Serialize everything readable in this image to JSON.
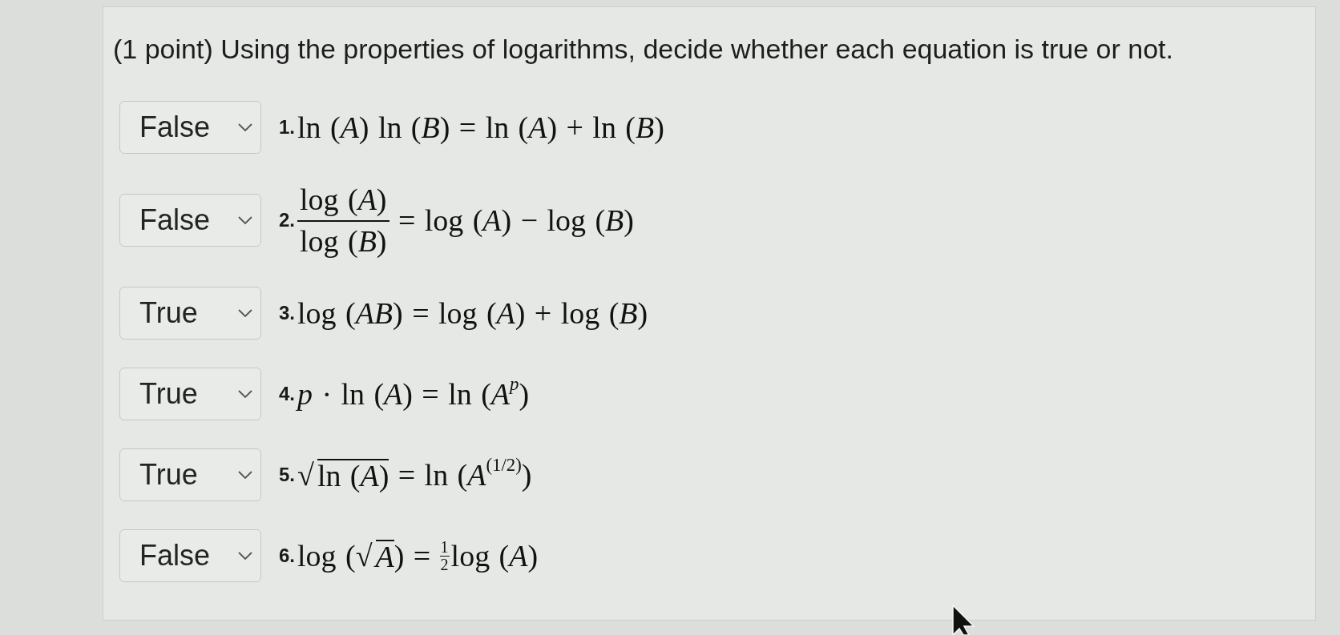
{
  "prompt": "(1 point) Using the properties of logarithms, decide whether each equation is true or not.",
  "questions": [
    {
      "answer": "False",
      "number": "1.",
      "equation": [
        {
          "kind": "text",
          "text": "ln (*A*) ln (*B*) = ln (*A*) + ln (*B*)"
        }
      ]
    },
    {
      "answer": "False",
      "number": "2.",
      "equation": [
        {
          "kind": "fraction",
          "numerator": "log (*A*)",
          "denominator": "log (*B*)"
        },
        {
          "kind": "text",
          "text": " = log (*A*) − log (*B*)"
        }
      ]
    },
    {
      "answer": "True",
      "number": "3.",
      "equation": [
        {
          "kind": "text",
          "text": "log (*AB*) = log (*A*) + log (*B*)"
        }
      ]
    },
    {
      "answer": "True",
      "number": "4.",
      "equation": [
        {
          "kind": "text",
          "text": "*p* · ln (*A*) = ln (*A*"
        },
        {
          "kind": "italic_superscript",
          "text": "p"
        },
        {
          "kind": "text",
          "text": ")"
        }
      ]
    },
    {
      "answer": "True",
      "number": "5.",
      "equation": [
        {
          "kind": "sqrt",
          "radical": "√",
          "radicand": "ln (*A*)"
        },
        {
          "kind": "text",
          "text": " = ln (*A*$^{(1/2)}$)"
        }
      ]
    },
    {
      "answer": "False",
      "number": "6.",
      "equation": [
        {
          "kind": "text",
          "text": "log ("
        },
        {
          "kind": "sqrt",
          "radical": "√",
          "radicand": "*A*"
        },
        {
          "kind": "text",
          "text": ") = "
        },
        {
          "kind": "small_fraction",
          "numerator": "1",
          "denominator": "2"
        },
        {
          "kind": "text",
          "text": "log (*A*)"
        }
      ]
    }
  ]
}
